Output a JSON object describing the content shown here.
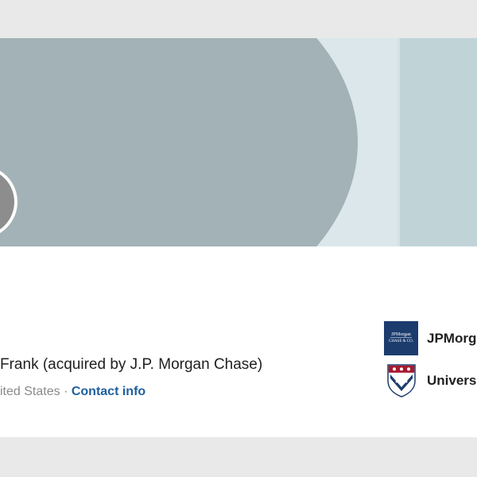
{
  "profile": {
    "headline": "Frank (acquired by J.P. Morgan Chase)",
    "location": "ited States",
    "separator": "·",
    "contact_info": "Contact info"
  },
  "experience": [
    {
      "label": "JPMorg",
      "logo": "jpmorgan-chase-logo",
      "logo_text": "JPMorgan Chase & Co."
    },
    {
      "label": "Univers",
      "logo": "upenn-shield-logo"
    }
  ],
  "colors": {
    "page_background": "#e9e9e9",
    "cover_arc": "#a2b2b6",
    "cover_band": "#dbe7ea",
    "cover_right": "#c0d4d8",
    "link": "#1f5f9e",
    "jpm_logo": "#1c3c6d",
    "upenn_red": "#a8192e",
    "upenn_blue": "#1c3c6d"
  }
}
